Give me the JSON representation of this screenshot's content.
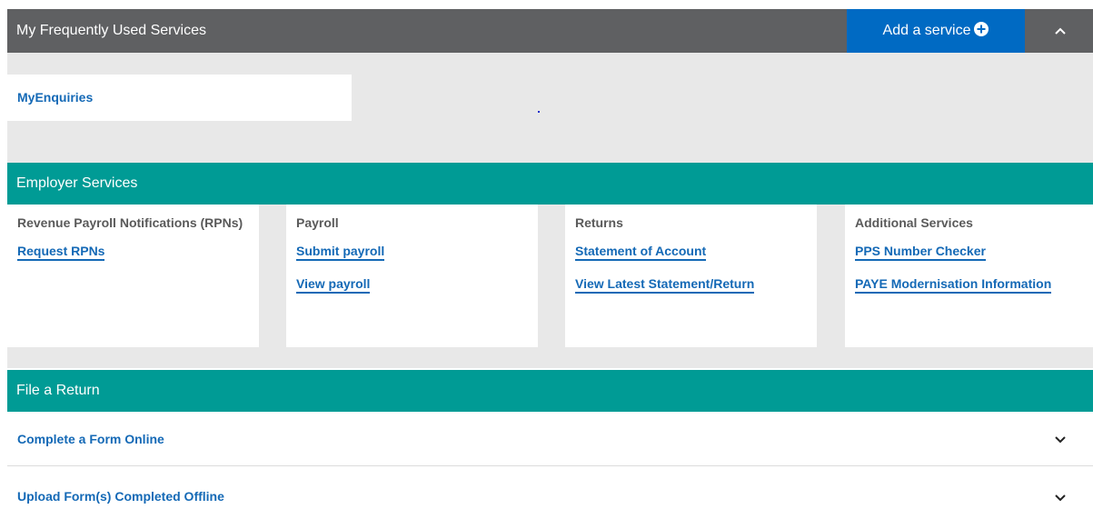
{
  "favourites": {
    "title": "My Frequently Used Services",
    "add_service_label": "Add a service",
    "items": [
      "MyEnquiries"
    ]
  },
  "employer_services": {
    "title": "Employer Services",
    "cards": [
      {
        "heading": "Revenue Payroll Notifications (RPNs)",
        "links": [
          "Request RPNs"
        ]
      },
      {
        "heading": "Payroll",
        "links": [
          "Submit payroll",
          "View payroll"
        ]
      },
      {
        "heading": "Returns",
        "links": [
          "Statement of Account",
          "View Latest Statement/Return"
        ]
      },
      {
        "heading": "Additional Services",
        "links": [
          "PPS Number Checker",
          "PAYE Modernisation Information"
        ]
      }
    ]
  },
  "file_a_return": {
    "title": "File a Return",
    "rows": [
      "Complete a Form Online",
      "Upload Form(s) Completed Offline"
    ]
  },
  "colors": {
    "dark_header": "#5f6062",
    "accent_blue": "#006ac3",
    "teal_header": "#009b95",
    "link_blue": "#1469b6",
    "panel_grey": "#e8e8e8"
  },
  "icons": {
    "add": "plus-circle-icon",
    "collapse": "chevron-up-icon",
    "expand": "chevron-down-icon"
  }
}
